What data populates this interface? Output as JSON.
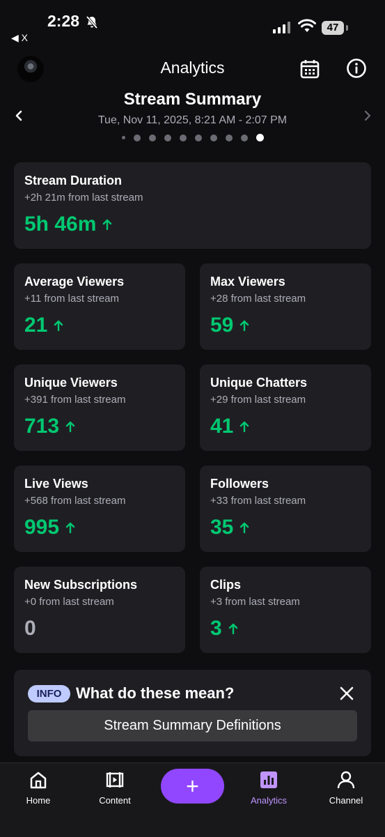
{
  "status_bar": {
    "time": "2:28",
    "battery": "47",
    "back_label": "◀ X"
  },
  "header": {
    "title": "Analytics"
  },
  "summary": {
    "title": "Stream Summary",
    "date_range": "Tue, Nov 11, 2025, 8:21 AM - 2:07 PM",
    "page_count": 10,
    "active_page": 10
  },
  "cards": {
    "stream_duration": {
      "title": "Stream Duration",
      "sub": "+2h 21m from last stream",
      "value": "5h 46m"
    },
    "average_viewers": {
      "title": "Average Viewers",
      "sub": "+11 from last stream",
      "value": "21"
    },
    "max_viewers": {
      "title": "Max Viewers",
      "sub": "+28 from last stream",
      "value": "59"
    },
    "unique_viewers": {
      "title": "Unique Viewers",
      "sub": "+391 from last stream",
      "value": "713"
    },
    "unique_chatters": {
      "title": "Unique Chatters",
      "sub": "+29 from last stream",
      "value": "41"
    },
    "live_views": {
      "title": "Live Views",
      "sub": "+568 from last stream",
      "value": "995"
    },
    "followers": {
      "title": "Followers",
      "sub": "+33 from last stream",
      "value": "35"
    },
    "new_subscriptions": {
      "title": "New Subscriptions",
      "sub": "+0 from last stream",
      "value": "0"
    },
    "clips": {
      "title": "Clips",
      "sub": "+3 from last stream",
      "value": "3"
    }
  },
  "info": {
    "badge": "INFO",
    "question": "What do these mean?",
    "button_label": "Stream Summary Definitions"
  },
  "nav": {
    "home": "Home",
    "content": "Content",
    "create": "+",
    "analytics": "Analytics",
    "channel": "Channel"
  },
  "colors": {
    "accent": "#9147ff",
    "positive": "#00c871",
    "card_bg": "#1f1f23",
    "page_bg": "#0e0e10"
  }
}
